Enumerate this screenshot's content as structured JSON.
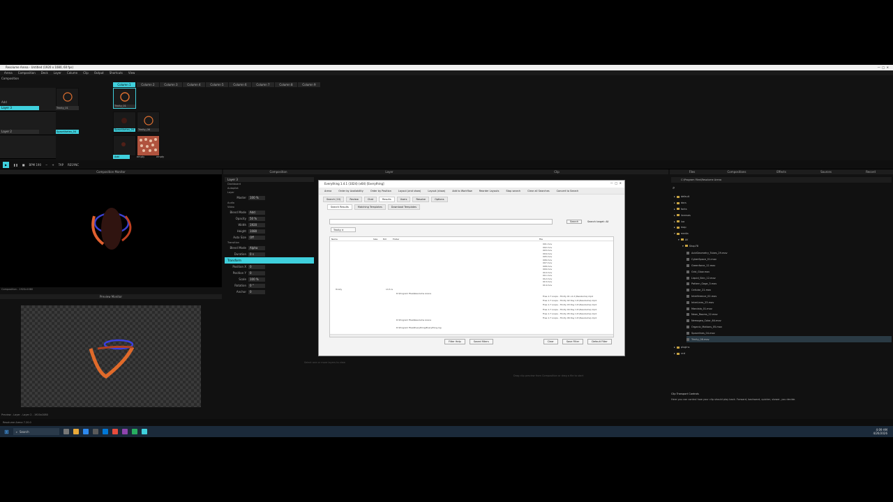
{
  "window": {
    "title": "Resolume Arena - Untitled (1920 x 1080, 60 fps)"
  },
  "menu": [
    "Arena",
    "Composition",
    "Deck",
    "Layer",
    "Column",
    "Clip",
    "Output",
    "Shortcuts",
    "View"
  ],
  "composition": {
    "label": "Composition",
    "columns": [
      "Column 1",
      "Column 2",
      "Column 3",
      "Column 4",
      "Column 5",
      "Column 6",
      "Column 7",
      "Column 8",
      "Column 9"
    ],
    "layers": [
      {
        "name": "Layer 3",
        "clips": [
          "Trinity_01",
          ""
        ]
      },
      {
        "name": "Layer 2",
        "clips": [
          "SpaceVortex_04",
          "Trinity_08"
        ]
      },
      {
        "name": "Layer 1",
        "clips": [
          "",
          ""
        ]
      }
    ],
    "footer_labels": [
      "Add",
      "empty",
      "empty"
    ],
    "blend": "Add"
  },
  "transport": {
    "bpm": "BPM 190",
    "tap": "TAP",
    "resync": "RESYNC"
  },
  "panels": {
    "composition_monitor": "Composition Monitor",
    "composition_status": "Composition - 1920x1080",
    "preview_monitor": "Preview Monitor",
    "preview_status": "Preview - Layer - Layer 2 - 1920x1080",
    "composition_tab": "Composition",
    "layer_tab": "Layer",
    "clip_tab": "Clip",
    "files_tab": "Files",
    "compositions_tab": "Compositions",
    "effects_tab": "Effects",
    "sources_tab": "Sources",
    "record_tab": "Record"
  },
  "layer_props": {
    "title": "Layer 3",
    "sections": [
      "Dashboard",
      "Autopilot",
      "Layer"
    ],
    "master": {
      "k": "Master",
      "v": "100 %"
    },
    "audio": "Audio",
    "video": "Video",
    "rows": [
      {
        "k": "Blend Mode",
        "v": "Add"
      },
      {
        "k": "Opacity",
        "v": "50 %"
      },
      {
        "k": "Width",
        "v": "1920"
      },
      {
        "k": "Height",
        "v": "1080"
      },
      {
        "k": "Auto Size",
        "v": "Off"
      }
    ],
    "transition": "Transition",
    "transition_rows": [
      {
        "k": "Blend Mode",
        "v": "Alpha"
      },
      {
        "k": "Duration",
        "v": "0 s"
      }
    ],
    "transform": "Transform",
    "transform_rows": [
      {
        "k": "Position X",
        "v": "0"
      },
      {
        "k": "Position Y",
        "v": "0"
      },
      {
        "k": "Scale",
        "v": "100 %"
      },
      {
        "k": "Rotation",
        "v": "0 °"
      },
      {
        "k": "Anchor",
        "v": "0"
      }
    ]
  },
  "dialog": {
    "title": "Everything 1.4.1 (1024) (x64) [Everything]",
    "toolbar": [
      "Arena",
      "Order by Availability",
      "Order by Position",
      "Layout (and show)",
      "Layout (show)",
      "Add to Workflow",
      "Reorder Layouts",
      "Stop search",
      "Clear all Searches",
      "Convert to Search"
    ],
    "tabs": [
      "Search (10)",
      "Review",
      "Chat",
      "Results",
      "Users",
      "Resolve",
      "Options"
    ],
    "active_tab": "Results",
    "subtabs": [
      "Search Results",
      "Matching Templates",
      "Download Templates"
    ],
    "search_button": "Search",
    "search_target": "Search target: All",
    "chip": "Trinity",
    "columns": [
      "Name",
      "Size",
      "Ext",
      "Folder",
      "File"
    ],
    "row_item": "Trinity",
    "row_size": "13.5 G",
    "row_path": "D:\\Program Files\\Resolume Arena",
    "row_path2": "D:\\Program Files\\Resolume Arena",
    "row_path3": "D:\\Program Files\\Everything\\Everything.log",
    "files_col": [
      "001.mov",
      "002.mov",
      "003.mov",
      "004.mov",
      "005.mov",
      "006.mov",
      "007.mov",
      "008.mov",
      "009.mov",
      "010.mov",
      "011.mov",
      "012.mov",
      "013.mov",
      "014.mov"
    ],
    "files_col_bottom": [
      "Free 1.7 Loops - Trinity 01 v1.2 (Resolume).mp4",
      "Free 1.7 Loops - Trinity 02 Day 1.8 (Resolume).mp4",
      "Free 1.7 Loops - Trinity 03 Day 1.8 (Resolume).mp4",
      "Free 1.7 Loops - Trinity 04 Day 1.8 (Resolume).mp4",
      "Free 1.7 Loops - Trinity 05 Day 1.8 (Resolume).mp4",
      "Free 1.7 Loops - Trinity 06 Day 1.8 (Resolume).mp4"
    ],
    "footer": [
      "Filter Help",
      "Saved filters",
      "Clear",
      "Save Filter",
      "Default Filter"
    ]
  },
  "files": {
    "path": "C:\\Program Files\\Resolume Arena",
    "tree": [
      "default",
      "docs",
      "fonts",
      "licenses",
      "lua",
      "map",
      "media",
      "AV",
      "Shop78"
    ],
    "clips": [
      "AcidGeometry_Tubes_29.mov",
      "CyberSpace_01.mov",
      "Greenforce_12.mov",
      "Grid_Glow.mov",
      "Liquid_Skin_12.mov",
      "Pattern_Gage_3.mov",
      "Cellular_21.mov",
      "Interference_02.mov",
      "InterLines_23.mov",
      "Mandala_01.mov",
      "Neon_Rooms_22.mov",
      "Nemogeo_Color_64.mov",
      "Organic_Motions_05.mov",
      "Spacelines_04.mov",
      "Trinity_08.mov"
    ],
    "tree_bottom": [
      "plugins",
      "vcd"
    ],
    "transport_title": "Clip Transport Controls",
    "transport_desc": "Here you can control how your clip should play back. Forward, backward, quicker, slower, you decide."
  },
  "hints": {
    "layer_empty": "Select one or more layers to view",
    "clip_empty": "Drag clip preview from Composition or drag a file to start"
  },
  "taskbar": {
    "search": "Search",
    "time": "4:09 AM",
    "date": "4/26/2026"
  },
  "status": {
    "version": "Resolume Arena 7.20.0"
  },
  "colors": {
    "accent": "#3fd0dd",
    "bg": "#121212"
  }
}
